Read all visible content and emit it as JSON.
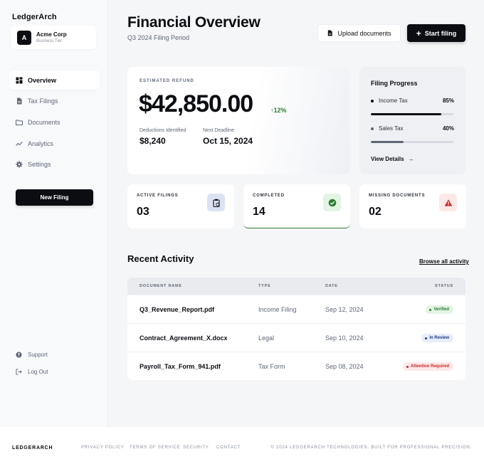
{
  "sidebar": {
    "brand": "LedgerArch",
    "org": {
      "avatar": "A",
      "name": "Acme Corp",
      "tier": "Business Tier"
    },
    "items": [
      {
        "label": "Overview",
        "icon": "grid-icon",
        "active": true
      },
      {
        "label": "Tax Filings",
        "icon": "file-icon"
      },
      {
        "label": "Documents",
        "icon": "folder-icon"
      },
      {
        "label": "Analytics",
        "icon": "trend-icon"
      },
      {
        "label": "Settings",
        "icon": "gear-icon"
      }
    ],
    "new_filing": "New Filing",
    "support": "Support",
    "logout": "Log Out"
  },
  "header": {
    "title": "Financial Overview",
    "subtitle": "Q3 2024 Filing Period",
    "upload_label": "Upload documents",
    "start_label": "Start filing"
  },
  "refund": {
    "label": "ESTIMATED REFUND",
    "amount": "$42,850.00",
    "delta": "12%",
    "deductions_label": "Deductions Identified",
    "deductions_value": "$8,240",
    "deadline_label": "Next Deadline",
    "deadline_value": "Oct 15, 2024"
  },
  "progress": {
    "title": "Filing Progress",
    "rows": [
      {
        "name": "Income Tax",
        "pct_label": "85%",
        "value": 0.85
      },
      {
        "name": "Sales Tax",
        "pct_label": "40%",
        "value": 0.4
      }
    ],
    "view_details": "View Details"
  },
  "stats": [
    {
      "label": "ACTIVE FILINGS",
      "value": "03",
      "icon": "clipboard-icon"
    },
    {
      "label": "COMPLETED",
      "value": "14",
      "icon": "check-circle-icon"
    },
    {
      "label": "MISSING DOCUMENTS",
      "value": "02",
      "icon": "warning-icon"
    }
  ],
  "activity": {
    "title": "Recent Activity",
    "browse_label": "Browse all activity",
    "columns": [
      "DOCUMENT NAME",
      "TYPE",
      "DATE",
      "STATUS"
    ],
    "rows": [
      {
        "name": "Q3_Revenue_Report.pdf",
        "type": "Income Filing",
        "date": "Sep 12, 2024",
        "status": "Verified"
      },
      {
        "name": "Contract_Agreement_X.docx",
        "type": "Legal",
        "date": "Sep 10, 2024",
        "status": "In Review"
      },
      {
        "name": "Payroll_Tax_Form_941.pdf",
        "type": "Tax Form",
        "date": "Sep 08, 2024",
        "status": "Attention Required"
      }
    ]
  },
  "footer": {
    "brand": "LEDGERARCH",
    "links": [
      "PRIVACY POLICY",
      "TERMS OF SERVICE",
      "SECURITY",
      "CONTACT"
    ],
    "copyright": "© 2024 LEDGERARCH TECHNOLOGIES. BUILT FOR PROFESSIONAL PRECISION."
  },
  "colors": {
    "primary": "#0b0d12",
    "success": "#2e7d32",
    "success_bg": "#e3f4e4",
    "info_bg": "#e8edf9",
    "info": "#1e3a8a",
    "danger": "#c62828",
    "danger_bg": "#fde8e8"
  }
}
